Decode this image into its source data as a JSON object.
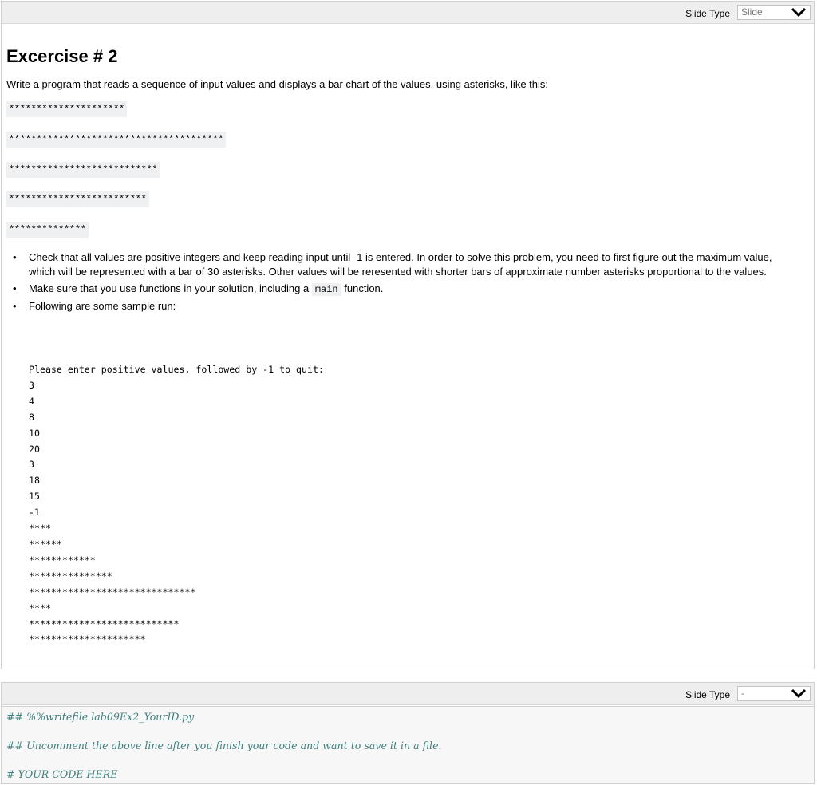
{
  "cell1": {
    "toolbar": {
      "slide_label": "Slide Type",
      "slide_value": "Slide"
    },
    "title": "Excercise # 2",
    "intro": "Write a program that reads a sequence of input values and displays a bar chart of the values, using asterisks, like this:",
    "asterisk_lines": [
      "*********************",
      "***************************************",
      "***************************",
      "*************************",
      "**************"
    ],
    "bullets": {
      "b1": "Check that all values are positive integers and keep reading input until -1 is entered. In order to solve this problem, you need to first figure out the maximum value, which will be represented with a bar of 30 asterisks. Other values will be reresented with shorter bars of approximate number asterisks proportional to the values.",
      "b2_pre": "Make sure that you use functions in your solution, including a ",
      "b2_code": "main",
      "b2_post": " function.",
      "b3": "Following are some sample run:"
    },
    "sample_run": "Please enter positive values, followed by -1 to quit:\n3\n4\n8\n10\n20\n3\n18\n15\n-1\n****\n******\n************\n***************\n******************************\n****\n***************************\n*********************"
  },
  "cell2": {
    "toolbar": {
      "slide_label": "Slide Type",
      "slide_value": "-"
    },
    "code_lines": [
      "## %%writefile lab09Ex2_YourID.py",
      "## Uncomment the above line after you finish your code and want to save it in a file.",
      "# YOUR CODE HERE"
    ]
  },
  "colors": {
    "comment": "#408080",
    "toolbar_bg": "#eeeeee",
    "code_bg": "#f7f7f7"
  },
  "icons": [
    "chevron-down-icon"
  ]
}
